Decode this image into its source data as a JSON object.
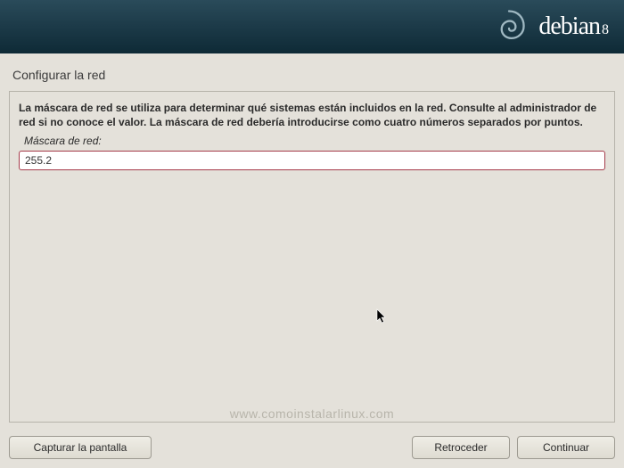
{
  "header": {
    "brand": "debian",
    "version": "8"
  },
  "page_title": "Configurar la red",
  "instructions": "La máscara de red se utiliza para determinar qué sistemas están incluidos en la red. Consulte al administrador de red si no conoce el valor. La máscara de red debería introducirse como cuatro números separados por puntos.",
  "field": {
    "label": "Máscara de red:",
    "value": "255.2"
  },
  "buttons": {
    "screenshot": "Capturar la pantalla",
    "back": "Retroceder",
    "continue": "Continuar"
  },
  "watermark": "www.comoinstalarlinux.com"
}
